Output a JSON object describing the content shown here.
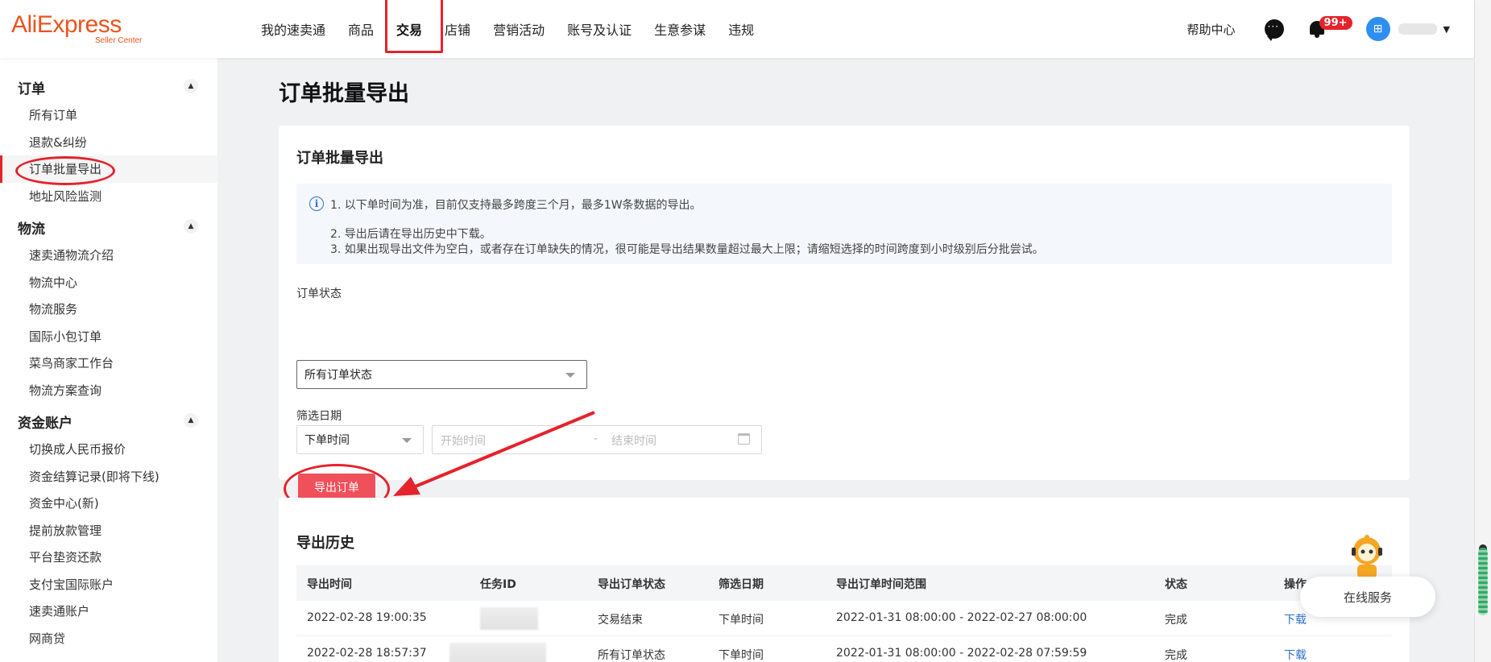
{
  "brand": {
    "name": "AliExpress",
    "sub": "Seller Center",
    "color": "#e8541e"
  },
  "nav": {
    "items": [
      "我的速卖通",
      "商品",
      "交易",
      "店铺",
      "营销活动",
      "账号及认证",
      "生意参谋",
      "违规"
    ],
    "active_index": 2
  },
  "header_right": {
    "help": "帮助中心",
    "badge": "99+",
    "avatar_glyph": "⊞"
  },
  "sidebar": {
    "groups": [
      {
        "label": "订单",
        "items": [
          "所有订单",
          "退款&纠纷",
          "订单批量导出",
          "地址风险监测"
        ]
      },
      {
        "label": "物流",
        "items": [
          "速卖通物流介绍",
          "物流中心",
          "物流服务",
          "国际小包订单",
          "菜鸟商家工作台",
          "物流方案查询"
        ]
      },
      {
        "label": "资金账户",
        "items": [
          "切换成人民币报价",
          "资金结算记录(即将下线)",
          "资金中心(新)",
          "提前放款管理",
          "平台垫资还款",
          "支付宝国际账户",
          "速卖通账户",
          "网商贷"
        ]
      }
    ],
    "active_item": "订单批量导出"
  },
  "page": {
    "title": "订单批量导出",
    "form_card": {
      "title": "订单批量导出",
      "notices": [
        "1. 以下单时间为准，目前仅支持最多跨度三个月，最多1W条数据的导出。",
        "2. 导出后请在导出历史中下载。",
        "3. 如果出现导出文件为空白，或者存在订单缺失的情况，很可能是导出结果数量超过最大上限；请缩短选择的时间跨度到小时级别后分批尝试。"
      ],
      "status_label": "订单状态",
      "status_value": "所有订单状态",
      "date_label": "筛选日期",
      "date_type": "下单时间",
      "start_placeholder": "开始时间",
      "range_sep": "-",
      "end_placeholder": "结束时间",
      "export_button": "导出订单"
    },
    "history": {
      "title": "导出历史",
      "columns": [
        "导出时间",
        "任务ID",
        "导出订单状态",
        "筛选日期",
        "导出订单时间范围",
        "状态",
        "操作"
      ],
      "rows": [
        {
          "time": "2022-02-28 19:00:35",
          "status_filter": "交易结束",
          "date_type": "下单时间",
          "range": "2022-01-31 08:00:00 - 2022-02-27 08:00:00",
          "state": "完成",
          "action": "下载"
        },
        {
          "time": "2022-02-28 18:57:37",
          "status_filter": "所有订单状态",
          "date_type": "下单时间",
          "range": "2022-01-31 08:00:00 - 2022-02-28 07:59:59",
          "state": "完成",
          "action": "下载"
        }
      ]
    }
  },
  "online_service": "在线服务",
  "accent_color": "#e4232b"
}
